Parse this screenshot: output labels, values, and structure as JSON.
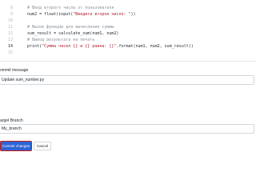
{
  "editor": {
    "lines": [
      {
        "num": "8",
        "segments": [
          {
            "t": "    # Ввод второго числа от пользователя",
            "c": "cmt"
          }
        ]
      },
      {
        "num": "9",
        "segments": [
          {
            "t": "    num2 = float(input(",
            "c": "fn"
          },
          {
            "t": "\"Введите второе число: \"",
            "c": "str"
          },
          {
            "t": "))",
            "c": "fn"
          }
        ]
      },
      {
        "num": "10",
        "segments": [
          {
            "t": "",
            "c": "fn"
          }
        ]
      },
      {
        "num": "11",
        "segments": [
          {
            "t": "    # Вызов функции для вычисления суммы",
            "c": "cmt"
          }
        ]
      },
      {
        "num": "12",
        "segments": [
          {
            "t": "    sum_result = calculate_sum(num1, num2)",
            "c": "fn"
          }
        ]
      },
      {
        "num": "13",
        "segments": [
          {
            "t": "    # Вывод результата на печать",
            "c": "cmt"
          }
        ]
      },
      {
        "num": "14",
        "segments": [
          {
            "t": "    print(",
            "c": "fn"
          },
          {
            "t": "\"Сумма чисел {} и {} равна: {}\"",
            "c": "str"
          },
          {
            "t": ".format(num1, num2, sum_result))",
            "c": "fn"
          }
        ]
      },
      {
        "num": "15",
        "segments": [
          {
            "t": "",
            "c": "fn"
          }
        ]
      }
    ],
    "active_line": "14"
  },
  "commit_message": {
    "label": "ommit message",
    "value": "Update sum_number.py"
  },
  "target_branch": {
    "label": "arget Branch",
    "value": "My_branch"
  },
  "buttons": {
    "commit": "Commit changes",
    "cancel": "Cancel"
  },
  "colors": {
    "primary_button": "#2f64d4",
    "highlight_border": "#c41a1a"
  }
}
